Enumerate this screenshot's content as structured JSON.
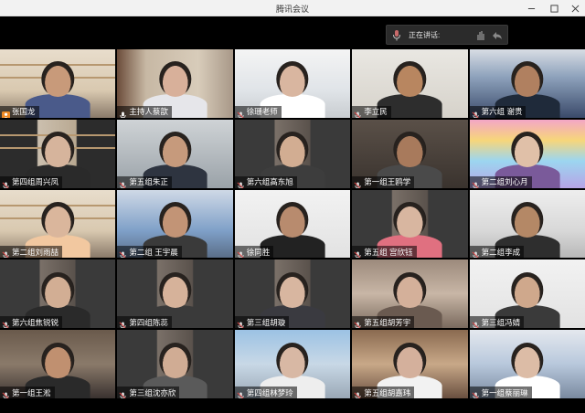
{
  "window": {
    "title": "腾讯会议"
  },
  "speaking": {
    "label": "正在讲话:"
  },
  "colors": {
    "stage": "#000000",
    "namebar": "rgba(0,0,0,0.55)",
    "host_badge": "#f08a24"
  },
  "participants": [
    {
      "name": "张国龙",
      "icon": "host-badge-icon",
      "scene": "shelf",
      "skin": "#c89a7a",
      "shirt": "#4a5a8a"
    },
    {
      "name": "主持人蔡歆",
      "icon": "mic-icon",
      "scene": "curtain",
      "skin": "#d8b09a",
      "shirt": "#e6e6ea"
    },
    {
      "name": "徐珊老师",
      "icon": "mic-muted-icon",
      "scene": "bright",
      "skin": "#d9b6a0",
      "shirt": "#ffffff"
    },
    {
      "name": "李立民",
      "icon": "mic-muted-icon",
      "scene": "wall",
      "skin": "#b88660",
      "shirt": "#2d2d2d"
    },
    {
      "name": "第六组 谢贵",
      "icon": "mic-muted-icon",
      "scene": "dorm",
      "skin": "#b08060",
      "shirt": "#1f2a3a"
    },
    {
      "name": "第四组周兴凤",
      "icon": "mic-muted-icon",
      "scene": "dark-shelf",
      "skin": "#d6b49c",
      "shirt": "#2a2a2a"
    },
    {
      "name": "第五组朱正",
      "icon": "mic-muted-icon",
      "scene": "grey",
      "skin": "#c69a7c",
      "shirt": "#2e3440"
    },
    {
      "name": "第六组高东旭",
      "icon": "mic-muted-icon",
      "scene": "dark-room",
      "skin": "#d2ad92",
      "shirt": "#3d3d3d"
    },
    {
      "name": "第一组王鸥学",
      "icon": "mic-muted-icon",
      "scene": "dim",
      "skin": "#a87a5c",
      "shirt": "#4a4a4a"
    },
    {
      "name": "第二组刘心月",
      "icon": "mic-muted-icon",
      "scene": "rainbow",
      "skin": "#e0c0a8",
      "shirt": "#7a5a9a"
    },
    {
      "name": "第二组刘雨喆",
      "icon": "mic-muted-icon",
      "scene": "shelf",
      "skin": "#dab69c",
      "shirt": "#f2c8a0"
    },
    {
      "name": "第二组 王宇晨",
      "icon": "mic-muted-icon",
      "scene": "room-blue",
      "skin": "#c29476",
      "shirt": "#3a3a3a"
    },
    {
      "name": "徐同胜",
      "icon": "mic-muted-icon",
      "scene": "white-wall",
      "skin": "#b88b6e",
      "shirt": "#222222"
    },
    {
      "name": "第五组 宫欣钰",
      "icon": "mic-muted-icon",
      "scene": "dark-room",
      "skin": "#d8b6a0",
      "shirt": "#e07080"
    },
    {
      "name": "第二组李成",
      "icon": "mic-muted-icon",
      "scene": "ceiling",
      "skin": "#b48866",
      "shirt": "#2e2e2e"
    },
    {
      "name": "第六组焦锐锐",
      "icon": "mic-muted-icon",
      "scene": "dark-room",
      "skin": "#d2ae94",
      "shirt": "#2a2a2a"
    },
    {
      "name": "第四组陈蕊",
      "icon": "mic-muted-icon",
      "scene": "dark-room",
      "skin": "#d6b29a",
      "shirt": "#3a3a3a"
    },
    {
      "name": "第三组胡璇",
      "icon": "mic-muted-icon",
      "scene": "dark-room",
      "skin": "#d8b6a0",
      "shirt": "#3a3a40"
    },
    {
      "name": "第五组胡芳宇",
      "icon": "mic-muted-icon",
      "scene": "blur-warm",
      "skin": "#d4b09a",
      "shirt": "#6a5a50"
    },
    {
      "name": "第三组冯婧",
      "icon": "mic-muted-icon",
      "scene": "white-wall",
      "skin": "#cfa88c",
      "shirt": "#3a3a3a"
    },
    {
      "name": "第一组王淞",
      "icon": "mic-muted-icon",
      "scene": "dorm-dark",
      "skin": "#c09070",
      "shirt": "#2a2a2a"
    },
    {
      "name": "第三组沈亦欣",
      "icon": "mic-muted-icon",
      "scene": "dark-room",
      "skin": "#d0ac94",
      "shirt": "#5a5a5a"
    },
    {
      "name": "第四组林梦玲",
      "icon": "mic-muted-icon",
      "scene": "blue-window",
      "skin": "#d8b8a4",
      "shirt": "#eeeeee"
    },
    {
      "name": "第五组胡嘉玮",
      "icon": "mic-muted-icon",
      "scene": "shelf-busy",
      "skin": "#d4b09c",
      "shirt": "#f2f2f2"
    },
    {
      "name": "第一组蔡丽琳",
      "icon": "mic-muted-icon",
      "scene": "dorm-bright",
      "skin": "#dcbca6",
      "shirt": "#ffffff"
    }
  ]
}
